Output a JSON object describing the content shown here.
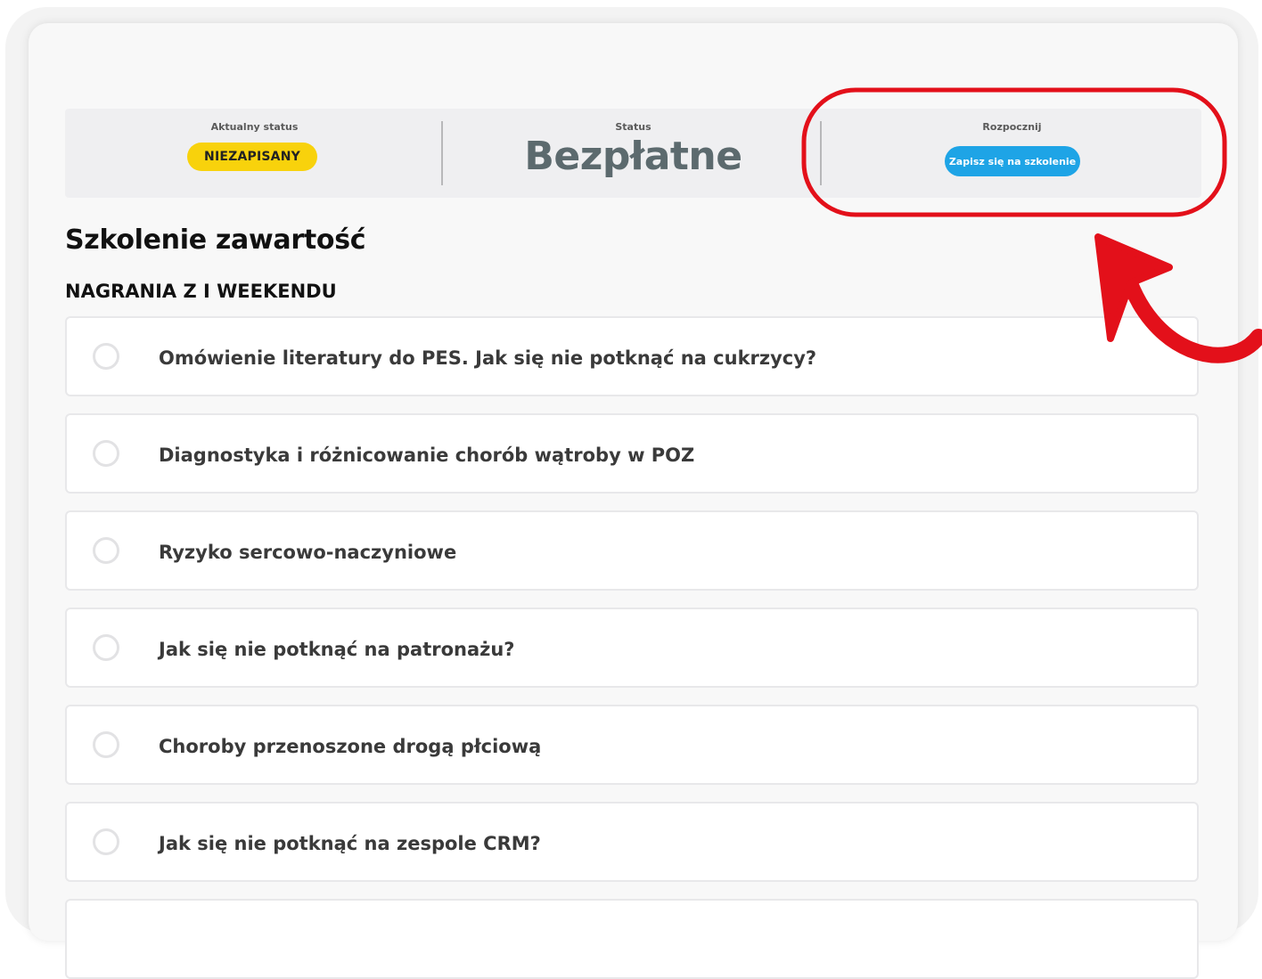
{
  "status_bar": {
    "current_status_label": "Aktualny status",
    "current_status_value": "NIEZAPISANY",
    "price_label": "Status",
    "price_value": "Bezpłatne",
    "start_label": "Rozpocznij",
    "enroll_button_label": "Zapisz się na szkolenie"
  },
  "content": {
    "title": "Szkolenie zawartość",
    "section_title": "NAGRANIA Z I WEEKENDU",
    "lessons": [
      {
        "label": "Omówienie literatury do PES. Jak się nie potknąć na cukrzycy?"
      },
      {
        "label": "Diagnostyka i różnicowanie chorób wątroby w POZ"
      },
      {
        "label": "Ryzyko sercowo-naczyniowe"
      },
      {
        "label": "Jak się nie potknąć na patronażu?"
      },
      {
        "label": "Choroby przenoszone drogą płciową"
      },
      {
        "label": "Jak się nie potknąć na zespole CRM?"
      },
      {
        "label": ""
      }
    ]
  },
  "colors": {
    "badge_yellow": "#f8d20c",
    "button_blue": "#1ea4e6",
    "annotation_red": "#e3101a"
  },
  "icons": {
    "lesson_status": "empty-circle-icon",
    "annotation": "curved-arrow-icon"
  }
}
